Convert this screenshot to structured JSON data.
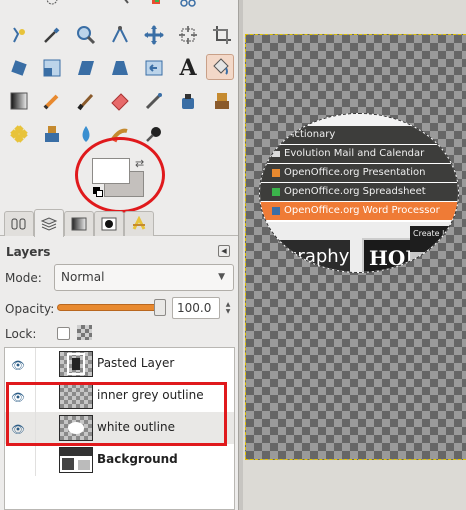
{
  "toolbox": {
    "tools": [
      "free-select-icon",
      "fuzzy-select-icon",
      "select-by-color-icon",
      "scissors-select-icon",
      "foreground-select-icon",
      "paths-icon",
      "color-picker-icon",
      "zoom-icon",
      "measure-icon",
      "move-icon",
      "align-icon",
      "crop-icon",
      "rotate-icon",
      "scale-icon",
      "shear-icon",
      "perspective-icon",
      "flip-icon",
      "text-icon",
      "bucket-fill-icon",
      "blend-icon",
      "pencil-icon",
      "paintbrush-icon",
      "eraser-icon",
      "airbrush-icon",
      "ink-icon",
      "clone-icon",
      "heal-icon",
      "perspective-clone-icon",
      "blur-icon",
      "smudge-icon",
      "dodge-burn-icon"
    ],
    "active_tool": "bucket-fill-icon",
    "colors": {
      "foreground": "#ffffff",
      "background": "#c4c0bd"
    }
  },
  "layers_panel": {
    "title": "Layers",
    "mode_label": "Mode:",
    "mode_value": "Normal",
    "opacity_label": "Opacity:",
    "opacity_value": "100.0",
    "opacity_fraction": 1.0,
    "lock_label": "Lock:",
    "layers": [
      {
        "name": "Pasted Layer",
        "visible": true,
        "bold": false
      },
      {
        "name": "inner grey outline",
        "visible": true,
        "bold": false
      },
      {
        "name": "white outline",
        "visible": true,
        "bold": false
      },
      {
        "name": "Background",
        "visible": false,
        "bold": true
      }
    ]
  },
  "canvas": {
    "menu_items": [
      "Dictionary",
      "Evolution Mail and Calendar",
      "OpenOffice.org Presentation",
      "OpenOffice.org Spreadsheet",
      "OpenOffice.org Word Processor"
    ],
    "highlighted_item": "OpenOffice.org Word Processor",
    "tooltip": "Create letter",
    "bottom_text_1": "graphy",
    "bottom_text_2": "HOL"
  },
  "colors": {
    "annotation_red": "#e0191c",
    "menu_highlight": "#ef7b36",
    "opacity_slider": "#e8892f"
  }
}
